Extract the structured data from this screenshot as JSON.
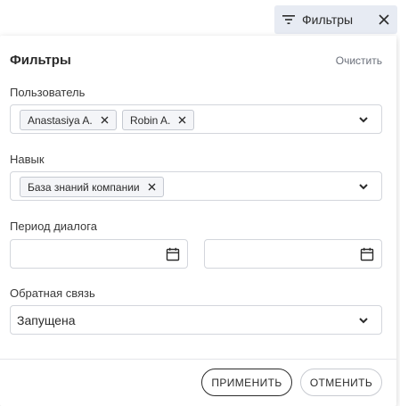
{
  "toggle": {
    "label": "Фильтры",
    "icon": "filter-icon",
    "close_icon": "close-icon"
  },
  "panel": {
    "title": "Фильтры",
    "clear_label": "Очистить"
  },
  "fields": {
    "user": {
      "label": "Пользователь",
      "chips": [
        "Anastasiya A.",
        "Robin A."
      ]
    },
    "skill": {
      "label": "Навык",
      "chips": [
        "База знаний компании"
      ]
    },
    "period": {
      "label": "Период диалога",
      "from_value": "",
      "to_value": ""
    },
    "feedback": {
      "label": "Обратная связь",
      "value": "Запущена"
    }
  },
  "buttons": {
    "apply": "ПРИМЕНИТЬ",
    "cancel": "ОТМЕНИТЬ"
  },
  "colors": {
    "toggle_bg": "#e7ebf3",
    "border": "#d3d6dc",
    "text": "#2b2b2b"
  }
}
